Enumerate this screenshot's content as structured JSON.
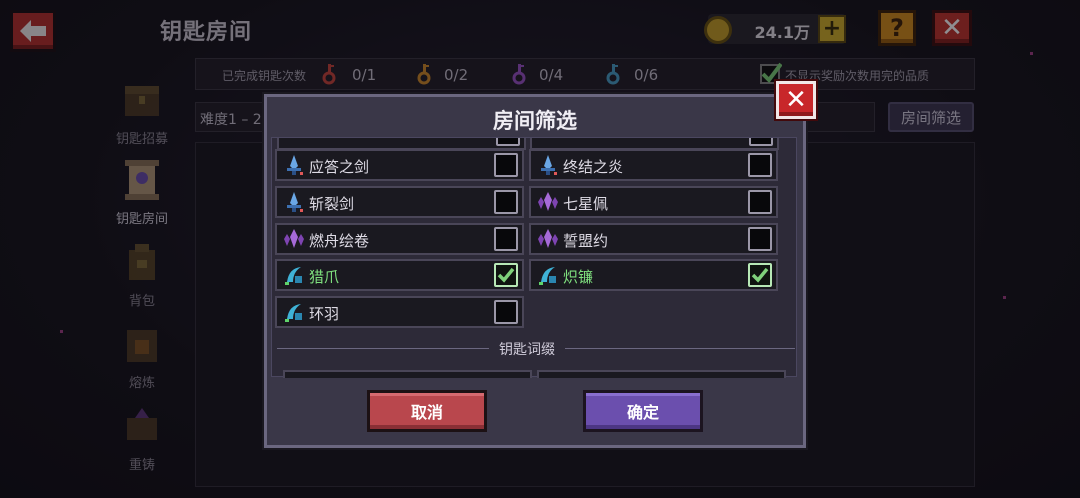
{
  "header": {
    "title": "钥匙房间",
    "coins": "24.1万"
  },
  "stats": {
    "label": "已完成钥匙次数",
    "keys": [
      {
        "color": "#c8453c",
        "count": "0/1"
      },
      {
        "color": "#d08a2a",
        "count": "0/2"
      },
      {
        "color": "#9b54c9",
        "count": "0/4"
      },
      {
        "color": "#4aa0c8",
        "count": "0/6"
      }
    ],
    "option_label": "不显示奖励次数用完的品质",
    "option_checked": true
  },
  "filters": {
    "difficulty": "难度1 – 2",
    "room_filter_button": "房间筛选"
  },
  "sidebar": {
    "items": [
      {
        "label": "钥匙招募"
      },
      {
        "label": "钥匙房间"
      },
      {
        "label": "背包"
      },
      {
        "label": "熔炼"
      },
      {
        "label": "重铸"
      }
    ]
  },
  "modal": {
    "title": "房间筛选",
    "items": [
      {
        "name": "应答之剑",
        "checked": false,
        "icon": "blue-sword-icon"
      },
      {
        "name": "终结之炎",
        "checked": false,
        "icon": "blue-sword-icon"
      },
      {
        "name": "斩裂剑",
        "checked": false,
        "icon": "blue-sword-icon"
      },
      {
        "name": "七星佩",
        "checked": false,
        "icon": "purple-crystal-icon"
      },
      {
        "name": "燃舟绘卷",
        "checked": false,
        "icon": "purple-crystal-icon"
      },
      {
        "name": "誓盟约",
        "checked": false,
        "icon": "purple-crystal-icon"
      },
      {
        "name": "猎爪",
        "checked": true,
        "icon": "cyan-claw-icon"
      },
      {
        "name": "炽镰",
        "checked": true,
        "icon": "cyan-claw-icon"
      },
      {
        "name": "环羽",
        "checked": false,
        "icon": "cyan-claw-icon"
      }
    ],
    "section_title": "钥匙词缀",
    "cancel_label": "取消",
    "confirm_label": "确定"
  }
}
